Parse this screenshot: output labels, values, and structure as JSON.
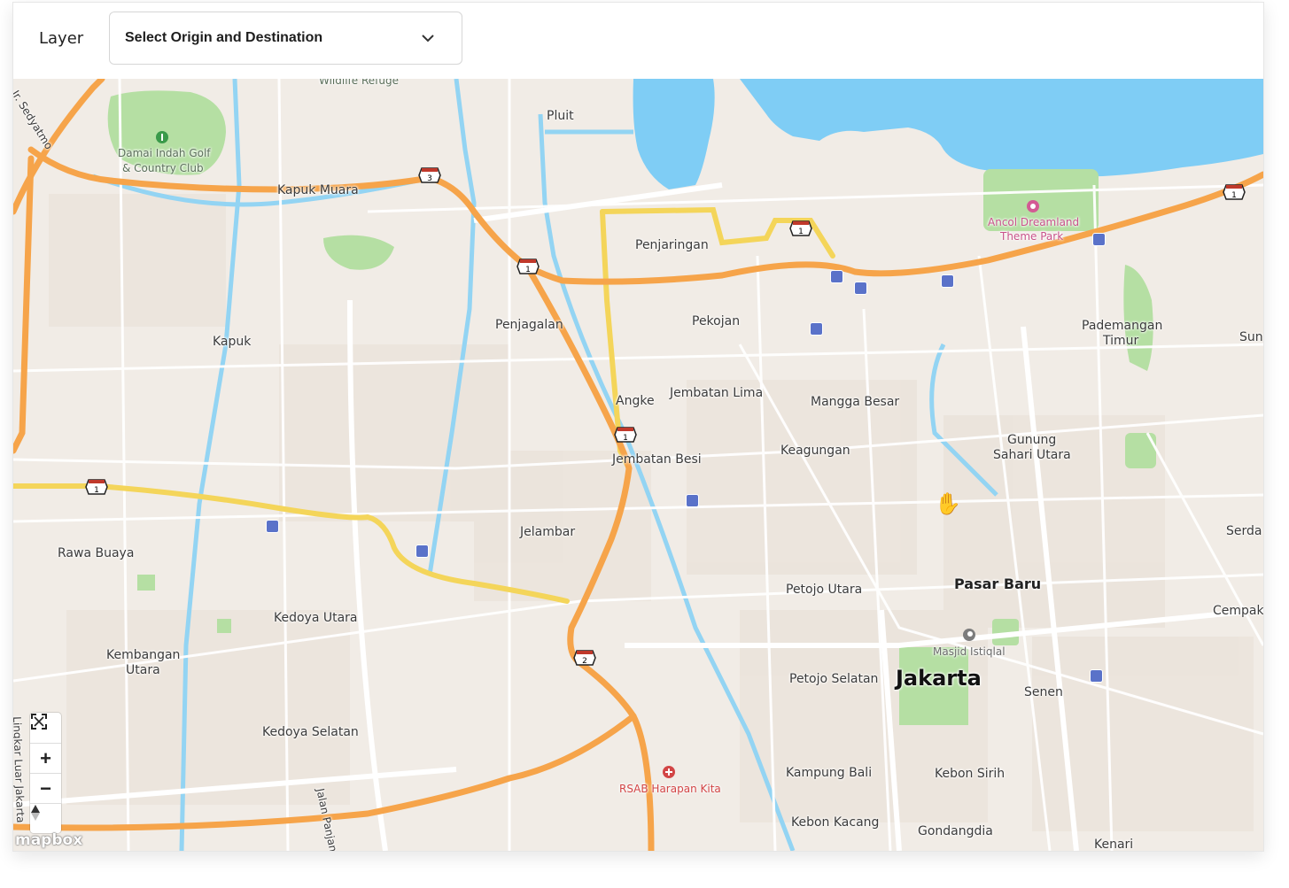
{
  "toolbar": {
    "layer_label": "Layer",
    "select_value": "Select Origin and Destination",
    "chevron_icon": "chevron-down-icon"
  },
  "map": {
    "labels": {
      "wildlife_refuge": "Wildlife Refuge",
      "pluit": "Pluit",
      "damai_indah_golf": "Damai Indah Golf",
      "country_club": "& Country Club",
      "kapuk_muara": "Kapuk Muara",
      "ancol_1": "Ancol Dreamland",
      "ancol_2": "Theme Park",
      "penjaringan": "Penjaringan",
      "pekojan": "Pekojan",
      "penjagalan": "Penjagalan",
      "kapuk": "Kapuk",
      "pademangan_1": "Pademangan",
      "pademangan_2": "Timur",
      "sun": "Sun",
      "angke": "Angke",
      "jembatan_lima": "Jembatan Lima",
      "mangga_besar": "Mangga Besar",
      "gunung_1": "Gunung",
      "gunung_2": "Sahari Utara",
      "keagungan": "Keagungan",
      "jembatan_besi": "Jembatan Besi",
      "jelambar": "Jelambar",
      "serda": "Serda",
      "rawa_buaya": "Rawa Buaya",
      "pasar_baru": "Pasar Baru",
      "petojo_utara": "Petojo Utara",
      "cempak": "Cempak",
      "kedoya_utara": "Kedoya Utara",
      "masjid_istiqlal": "Masjid Istiqlal",
      "kembangan_1": "Kembangan",
      "kembangan_2": "Utara",
      "petojo_selatan": "Petojo Selatan",
      "jakarta": "Jakarta",
      "senen": "Senen",
      "kedoya_selatan": "Kedoya Selatan",
      "jalan_panjang_raya": "Jalan Panjang Raya",
      "rsab": "RSAB Harapan Kita",
      "kampung_bali": "Kampung Bali",
      "kebon_sirih": "Kebon Sirih",
      "kebon_kacang": "Kebon Kacang",
      "gondangdia": "Gondangdia",
      "kenari": "Kenari",
      "sedyatmo": "Ir. Sedyatmo",
      "lingkar_luar": "Lingkar Luar Jakarta"
    },
    "shields": [
      "3",
      "1",
      "1",
      "1",
      "1",
      "2",
      "1"
    ],
    "controls": {
      "fullscreen_icon": "fullscreen-icon",
      "zoom_in": "+",
      "zoom_out": "−",
      "compass_icon": "compass-icon"
    },
    "attribution": "mapbox",
    "colors": {
      "land": "#f1ece6",
      "water": "#7fcdf5",
      "park": "#b5dfa3",
      "highway": "#f6a44a",
      "trunk": "#f4d55a",
      "road": "#ffffff",
      "transit": "#5a72c9"
    }
  }
}
